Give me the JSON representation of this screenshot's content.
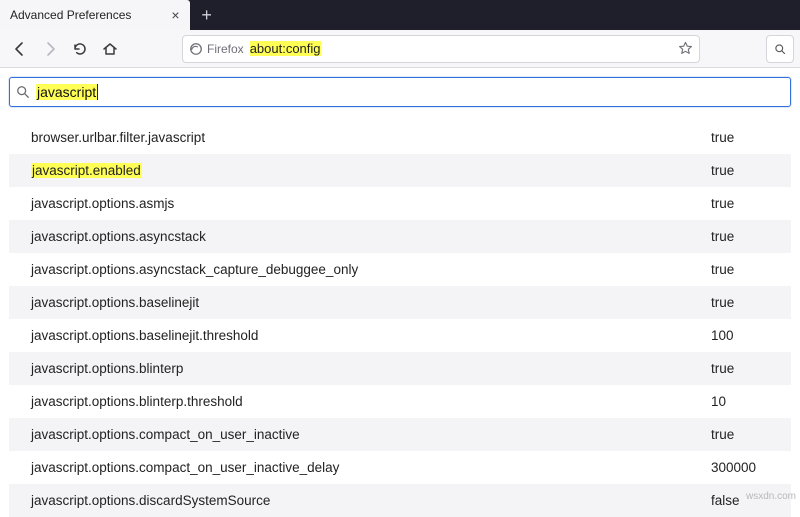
{
  "tab": {
    "title": "Advanced Preferences"
  },
  "urlbar": {
    "identity": "Firefox",
    "address_prefix": "",
    "address_hl": "about:config"
  },
  "search": {
    "query": "javascript"
  },
  "prefs": [
    {
      "name": "browser.urlbar.filter.javascript",
      "value": "true",
      "highlighted": false
    },
    {
      "name": "javascript.enabled",
      "value": "true",
      "highlighted": true
    },
    {
      "name": "javascript.options.asmjs",
      "value": "true",
      "highlighted": false
    },
    {
      "name": "javascript.options.asyncstack",
      "value": "true",
      "highlighted": false
    },
    {
      "name": "javascript.options.asyncstack_capture_debuggee_only",
      "value": "true",
      "highlighted": false
    },
    {
      "name": "javascript.options.baselinejit",
      "value": "true",
      "highlighted": false
    },
    {
      "name": "javascript.options.baselinejit.threshold",
      "value": "100",
      "highlighted": false
    },
    {
      "name": "javascript.options.blinterp",
      "value": "true",
      "highlighted": false
    },
    {
      "name": "javascript.options.blinterp.threshold",
      "value": "10",
      "highlighted": false
    },
    {
      "name": "javascript.options.compact_on_user_inactive",
      "value": "true",
      "highlighted": false
    },
    {
      "name": "javascript.options.compact_on_user_inactive_delay",
      "value": "300000",
      "highlighted": false
    },
    {
      "name": "javascript.options.discardSystemSource",
      "value": "false",
      "highlighted": false
    }
  ],
  "watermark": "wsxdn.com"
}
